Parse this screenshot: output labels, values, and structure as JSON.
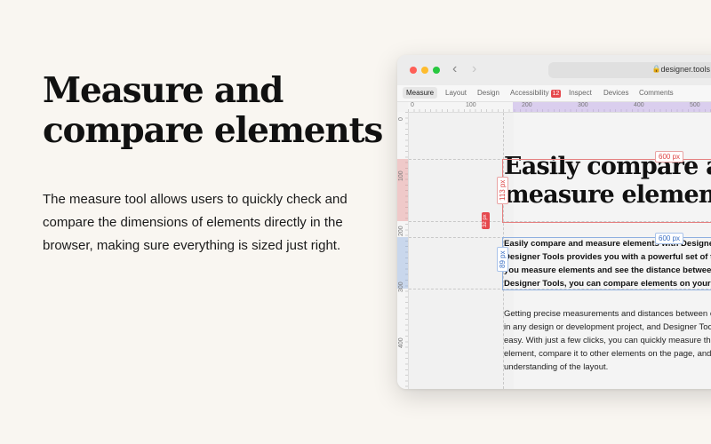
{
  "hero": {
    "title_line1": "Measure and",
    "title_line2": "compare elements",
    "description": "The measure tool allows users to quickly check and compare the dimensions of elements directly in the browser, making sure everything is sized just right."
  },
  "browser": {
    "url": "designer.tools",
    "tabs": [
      {
        "label": "Measure"
      },
      {
        "label": "Layout"
      },
      {
        "label": "Design"
      },
      {
        "label": "Accessibility",
        "badge": "12"
      },
      {
        "label": "Inspect"
      },
      {
        "label": "Devices"
      },
      {
        "label": "Comments"
      }
    ],
    "ruler_h": [
      "0",
      "100",
      "200",
      "300",
      "400",
      "500"
    ],
    "ruler_v": [
      "0",
      "100",
      "200",
      "300",
      "400"
    ]
  },
  "measure": {
    "heading_width": "600 px",
    "heading_height": "113 px",
    "para_width": "600 px",
    "para_height": "89 px",
    "gap": "32 px"
  },
  "site": {
    "heading_line1": "Easily compare and",
    "heading_line2": "measure elements",
    "para1": "Easily compare and measure elements with Designer Tools. Designer Tools provides you with a powerful set of tools to help you measure elements and see the distance between them. With Designer Tools, you can compare elements on your page.",
    "para2": "Getting precise measurements and distances between elements is key in any design or development project, and Designer Tools makes it easy. With just a few clicks, you can quickly measure the size of an element, compare it to other elements on the page, and get a clear understanding of the layout."
  },
  "colors": {
    "background": "#f9f6f1",
    "measure_red": "#e5484d",
    "measure_blue": "#3a6fc4",
    "ruler_highlight": "#baa0e6"
  }
}
